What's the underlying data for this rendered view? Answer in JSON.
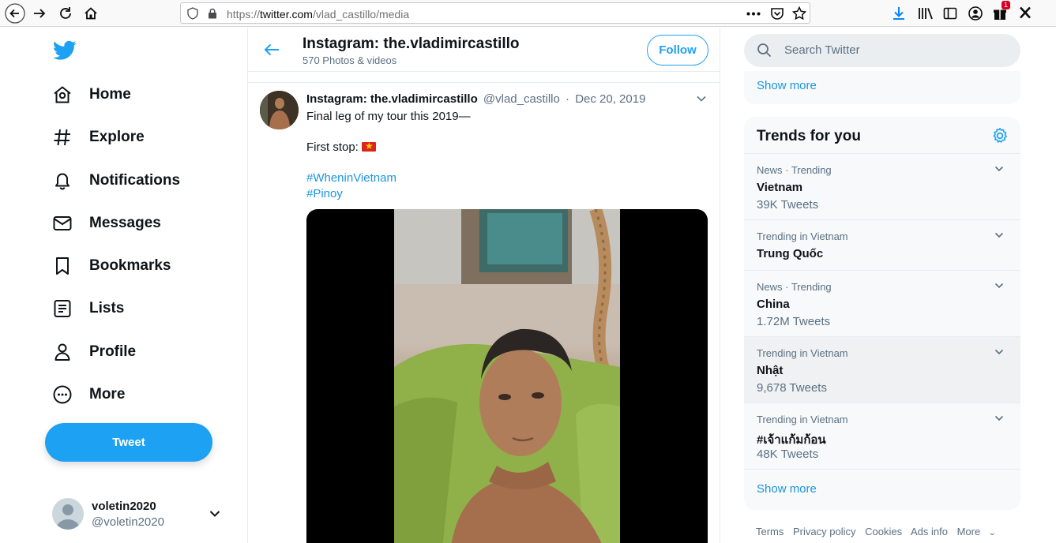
{
  "browser": {
    "url_scheme": "https://",
    "url_host": "twitter.com",
    "url_path": "/vlad_castillo/media",
    "notification_badge": "1"
  },
  "nav": {
    "items": [
      {
        "label": "Home",
        "icon": "home-icon"
      },
      {
        "label": "Explore",
        "icon": "hashtag-icon"
      },
      {
        "label": "Notifications",
        "icon": "bell-icon"
      },
      {
        "label": "Messages",
        "icon": "envelope-icon"
      },
      {
        "label": "Bookmarks",
        "icon": "bookmark-icon"
      },
      {
        "label": "Lists",
        "icon": "list-icon"
      },
      {
        "label": "Profile",
        "icon": "person-icon"
      },
      {
        "label": "More",
        "icon": "more-circle-icon"
      }
    ],
    "tweet_button": "Tweet"
  },
  "account": {
    "name": "voletin2020",
    "handle": "@voletin2020"
  },
  "profile": {
    "title": "Instagram: the.vladimircastillo",
    "subtitle": "570 Photos & videos",
    "follow_label": "Follow"
  },
  "tweet": {
    "author_name": "Instagram: the.vladimircastillo",
    "author_handle": "@vlad_castillo",
    "separator": "·",
    "date": "Dec 20, 2019",
    "line1": "Final leg of my tour this 2019—",
    "line2": "First stop:",
    "hashtag1": "#WheninVietnam",
    "hashtag2": "#Pinoy"
  },
  "search": {
    "placeholder": "Search Twitter"
  },
  "sidebar": {
    "show_more_top": "Show more",
    "trends_title": "Trends for you",
    "trends": [
      {
        "context": "News · Trending",
        "name": "Vietnam",
        "count": "39K Tweets"
      },
      {
        "context": "Trending in Vietnam",
        "name": "Trung Quốc",
        "count": ""
      },
      {
        "context": "News · Trending",
        "name": "China",
        "count": "1.72M Tweets"
      },
      {
        "context": "Trending in Vietnam",
        "name": "Nhật",
        "count": "9,678 Tweets"
      },
      {
        "context": "Trending in Vietnam",
        "name": "#เจ้าแก้มก้อน",
        "count": "48K Tweets"
      }
    ],
    "show_more_bottom": "Show more"
  },
  "footer": {
    "links": [
      "Terms",
      "Privacy policy",
      "Cookies",
      "Ads info",
      "More"
    ]
  },
  "colors": {
    "accent": "#1da1f2",
    "link": "#1b95e0",
    "muted": "#5b7083"
  }
}
